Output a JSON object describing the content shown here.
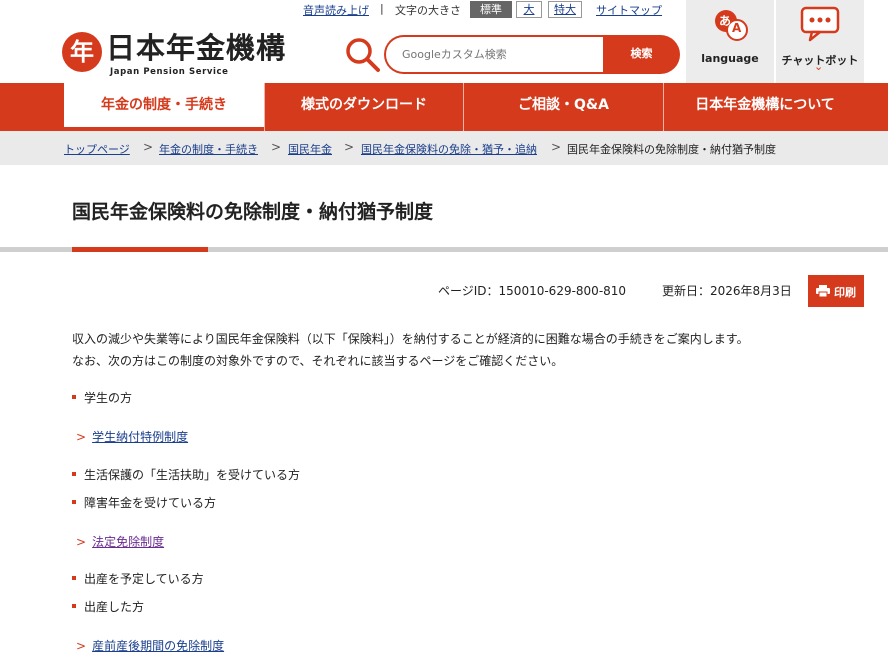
{
  "utility": {
    "read_aloud": "音声読み上げ",
    "separator": "|",
    "font_size_label": "文字の大きさ",
    "font_sizes": [
      "標準",
      "大",
      "特大"
    ],
    "sitemap": "サイトマップ"
  },
  "logo": {
    "mark": "年",
    "name": "日本年金機構",
    "subtitle": "Japan Pension Service"
  },
  "search": {
    "placeholder": "Googleカスタム検索",
    "button": "検索"
  },
  "tools": {
    "language_label": "language",
    "language_glyph": "あ",
    "language_glyph2": "A",
    "chatbot_label": "チャットボット",
    "chatbot_chevron": "⌄"
  },
  "nav": {
    "items": [
      "年金の制度・手続き",
      "様式のダウンロード",
      "ご相談・Q&A",
      "日本年金機構について"
    ]
  },
  "breadcrumb": {
    "items": [
      "トップページ",
      "年金の制度・手続き",
      "国民年金",
      "国民年金保険料の免除・猶予・追納",
      "国民年金保険料の免除制度・納付猶予制度"
    ],
    "arrow": ">"
  },
  "page": {
    "title": "国民年金保険料の免除制度・納付猶予制度",
    "page_id": "ページID：150010-629-800-810",
    "updated": "更新日：2026年8月3日",
    "print": "印刷"
  },
  "content": {
    "intro1": "収入の減少や失業等により国民年金保険料（以下「保険料」）を納付することが経済的に困難な場合の手続きをご案内します。",
    "intro2": "なお、次の方はこの制度の対象外ですので、それぞれに該当するページをご確認ください。",
    "bullet_student": "学生の方",
    "link_student": "学生納付特例制度",
    "bullet_welfare": "生活保護の「生活扶助」を受けている方",
    "bullet_disability": "障害年金を受けている方",
    "link_legal": "法定免除制度",
    "bullet_expecting": "出産を予定している方",
    "bullet_gave_birth": "出産した方",
    "link_maternity": "産前産後期間の免除制度",
    "chevron": ">"
  },
  "colors": {
    "brand": "#d53a1c",
    "link": "#1a3f8c",
    "visited": "#6b2c91"
  }
}
